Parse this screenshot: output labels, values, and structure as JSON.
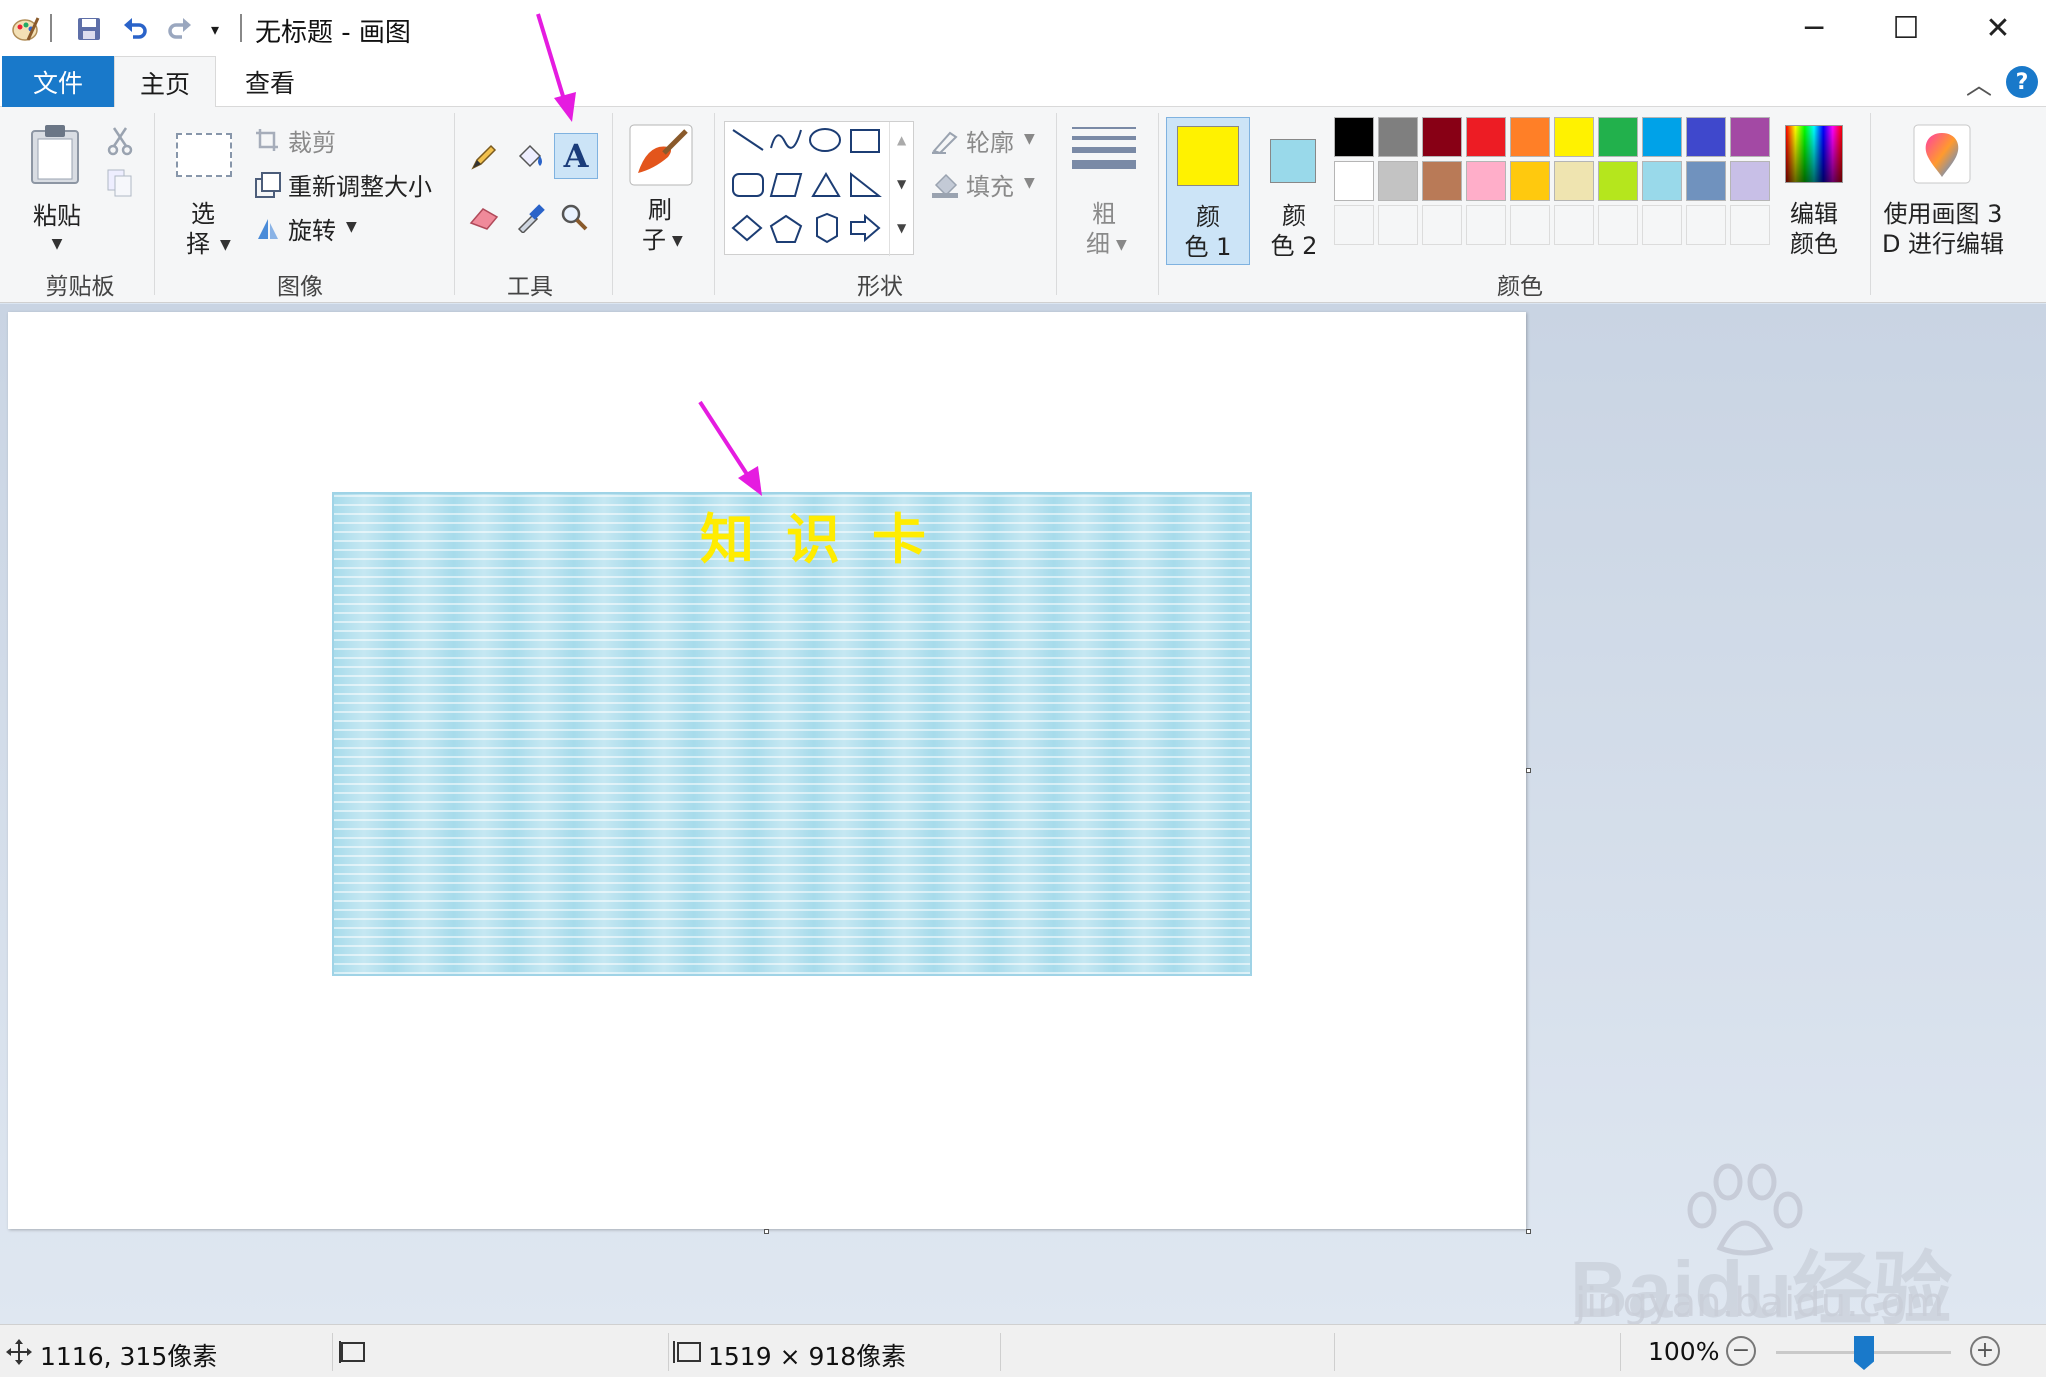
{
  "titlebar": {
    "title": "无标题 - 画图",
    "minimize": "─",
    "maximize": "☐",
    "close": "✕"
  },
  "tabs": {
    "file": "文件",
    "home": "主页",
    "view": "查看"
  },
  "ribbon": {
    "clipboard": {
      "paste": "粘贴",
      "group": "剪贴板"
    },
    "image": {
      "select_line1": "选",
      "select_line2": "择",
      "crop": "裁剪",
      "resize": "重新调整大小",
      "rotate": "旋转",
      "group": "图像"
    },
    "tools": {
      "group": "工具"
    },
    "brushes": {
      "line1": "刷",
      "line2": "子"
    },
    "shapes": {
      "outline": "轮廓",
      "fill": "填充",
      "group": "形状"
    },
    "size": {
      "line1": "粗",
      "line2": "细"
    },
    "colors": {
      "color1_line1": "颜",
      "color1_line2": "色 1",
      "color2_line1": "颜",
      "color2_line2": "色 2",
      "edit_line1": "编辑",
      "edit_line2": "颜色",
      "paint3d_line1": "使用画图 3",
      "paint3d_line2": "D 进行编辑",
      "group": "颜色",
      "color1_value": "#fff200",
      "color2_value": "#99d9ea",
      "palette_row1": [
        "#000000",
        "#7f7f7f",
        "#880015",
        "#ed1c24",
        "#ff7f27",
        "#fff200",
        "#22b14c",
        "#00a2e8",
        "#3f48cc",
        "#a349a4"
      ],
      "palette_row2": [
        "#ffffff",
        "#c3c3c3",
        "#b97a57",
        "#ffaec9",
        "#ffc90e",
        "#efe4b0",
        "#b5e61d",
        "#99d9ea",
        "#7092be",
        "#c8bfe7"
      ]
    }
  },
  "canvas": {
    "card_title": "知识卡",
    "card_color": "#a7dbeb",
    "title_color": "#ffec00"
  },
  "status": {
    "cursor_pos": "1116, 315像素",
    "image_size": "1519 × 918像素",
    "zoom": "100%",
    "zoom_out": "−",
    "zoom_in": "+"
  },
  "watermark": {
    "brand": "Baidu经验",
    "url": "jingyan.baidu.com"
  }
}
